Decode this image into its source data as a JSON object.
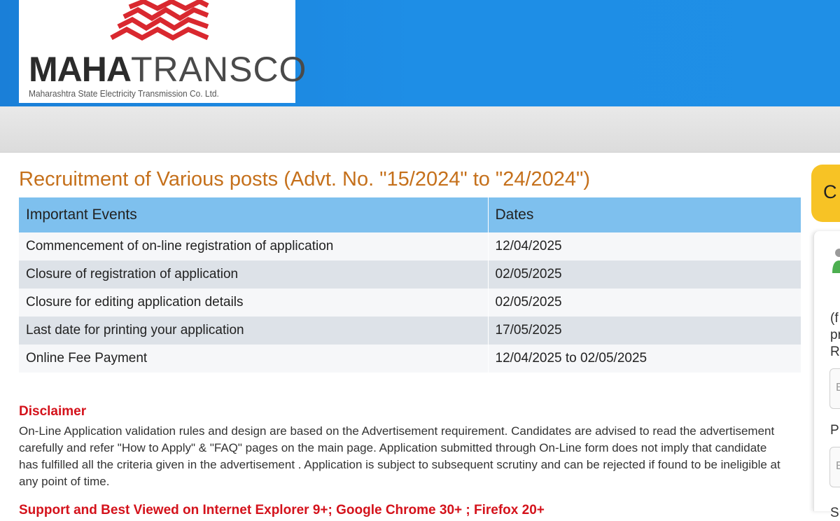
{
  "header": {
    "logo_bold": "MAHA",
    "logo_light": "TRANSCO",
    "logo_tagline": "Maharashtra State Electricity Transmission Co. Ltd.",
    "colors": {
      "header_blue": "#1e8ee6",
      "logo_red": "#d9282f"
    }
  },
  "main": {
    "title": "Recruitment of Various posts (Advt. No. \"15/2024\" to \"24/2024\")",
    "table": {
      "headers": [
        "Important Events",
        "Dates"
      ],
      "rows": [
        [
          "Commencement of on-line registration of application",
          "12/04/2025"
        ],
        [
          "Closure of registration of application",
          "02/05/2025"
        ],
        [
          "Closure for editing application details",
          "02/05/2025"
        ],
        [
          "Last date for printing your application",
          "17/05/2025"
        ],
        [
          "Online Fee Payment",
          "12/04/2025 to 02/05/2025"
        ]
      ]
    },
    "disclaimer_title": "Disclaimer",
    "disclaimer_text": "On-Line Application validation rules and design are based on the Advertisement requirement. Candidates are advised to read the advertisement carefully and refer \"How to Apply\" & \"FAQ\" pages on the main page. Application submitted through On-Line form does not imply that candidate has fulfilled all the criteria given in the advertisement . Application is subject to subsequent scrutiny and can be rejected if found to be ineligible at any point of time.",
    "support_text": "Support and Best Viewed on Internet Explorer 9+; Google Chrome 30+ ; Firefox 20+"
  },
  "side": {
    "tab_fragment": "C",
    "frag_1": "(f",
    "frag_2": "pr",
    "frag_3": "R",
    "input_1_frag": "E",
    "frag_4": "P",
    "input_2_frag": "E",
    "frag_5": "S",
    "icons": [
      "user-icon"
    ]
  }
}
